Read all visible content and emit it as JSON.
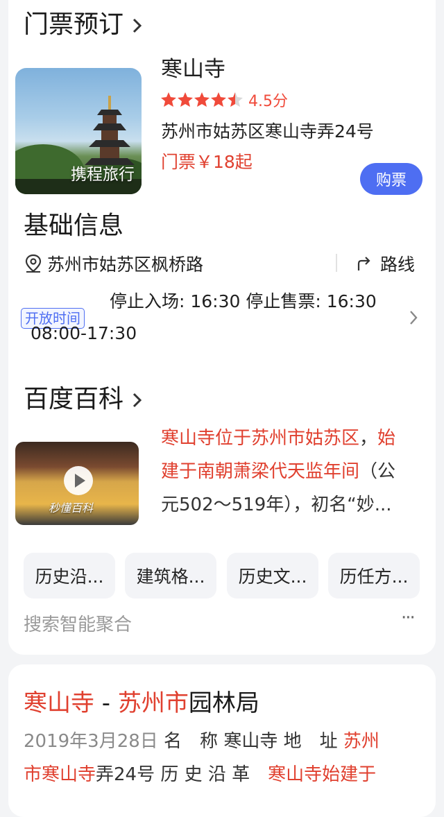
{
  "ticket": {
    "section_title": "门票预订",
    "thumb_label": "携程旅行",
    "name": "寒山寺",
    "rating_text": "4.5分",
    "rating_value": 4.5,
    "address": "苏州市姑苏区寒山寺弄24号",
    "price": "门票￥18起",
    "buy_label": "购票"
  },
  "info": {
    "section_title": "基础信息",
    "location": "苏州市姑苏区枫桥路",
    "route_label": "路线",
    "hours_tag": "开放时间",
    "hours_line1": "停止入场: 16:30 停止售票: 16:30",
    "hours_line2": "08:00-17:30"
  },
  "baike": {
    "section_title": "百度百科",
    "video_label": "秒懂百科",
    "summary_line1_red": "寒山寺位于苏州市姑苏区",
    "summary_line1_sep": "，",
    "summary_line1_red2": "始",
    "summary_line2_red": "建于南朝萧梁代天监年间",
    "summary_line2_rest": "（公",
    "summary_line3": "元502～519年），初名“妙...",
    "chips": [
      "历史沿...",
      "建筑格...",
      "历史文...",
      "历任方..."
    ]
  },
  "footer": {
    "label": "搜索智能聚合",
    "more": "···"
  },
  "result": {
    "title_red1": "寒山寺",
    "title_sep": " - ",
    "title_red2": "苏州市",
    "title_rest": "园林局",
    "date": "2019年3月28日",
    "line1_rest": " 名　称 寒山寺 地　址 ",
    "line1_red": "苏州",
    "line2_red": "市寒山寺",
    "line2_mid": "弄24号 历 史 沿 革　",
    "line2_red2": "寒山寺始建于"
  },
  "colors": {
    "accent": "#4e6ef2",
    "red": "#e0402f",
    "star": "#f04a3a"
  }
}
